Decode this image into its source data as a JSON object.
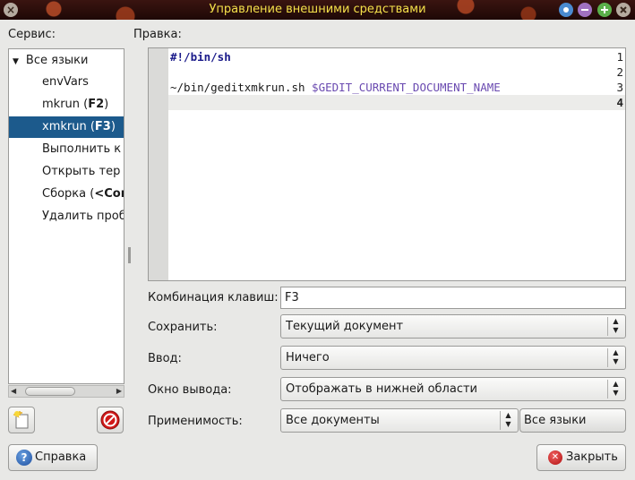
{
  "window": {
    "title": "Управление внешними средствами",
    "close_glyph": "×"
  },
  "left": {
    "label": "Сервис:",
    "tree": {
      "root": "Все языки",
      "items": [
        {
          "pre": "envVars",
          "bold": "",
          "post": ""
        },
        {
          "pre": "mkrun (",
          "bold": "F2",
          "post": ")"
        },
        {
          "pre": "xmkrun (",
          "bold": "F3",
          "post": ")"
        },
        {
          "pre": "Выполнить к",
          "bold": "",
          "post": ""
        },
        {
          "pre": "Открыть тер",
          "bold": "",
          "post": ""
        },
        {
          "pre": "Сборка (",
          "bold": "<Con",
          "post": ""
        },
        {
          "pre": "Удалить проб",
          "bold": "",
          "post": ""
        }
      ]
    }
  },
  "editor": {
    "label": "Правка:",
    "line_numbers": [
      "1",
      "2",
      "3",
      "4"
    ],
    "line1": "#!/bin/sh",
    "line3_path": "~/bin/geditxmkrun.sh",
    "line3_var": "$GEDIT_CURRENT_DOCUMENT_NAME"
  },
  "form": {
    "shortcut_label": "Комбинация клавиш:",
    "shortcut_value": "F3",
    "save_label": "Сохранить:",
    "save_value": "Текущий документ",
    "input_label": "Ввод:",
    "input_value": "Ничего",
    "output_label": "Окно вывода:",
    "output_value": "Отображать в нижней области",
    "applicability_label": "Применимость:",
    "applicability_value": "Все документы",
    "languages_button": "Все языки"
  },
  "footer": {
    "help_button": "Справка",
    "close_button": "Закрыть"
  }
}
